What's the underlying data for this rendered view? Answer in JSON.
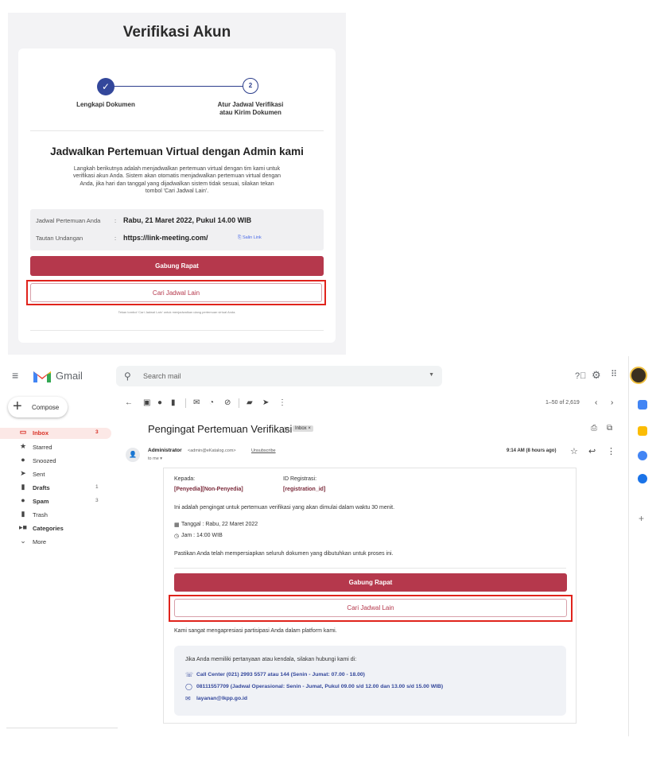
{
  "verification": {
    "title": "Verifikasi Akun",
    "step1_label": "Lengkapi Dokumen",
    "step1_icon": "check-icon",
    "step2_number": "2",
    "step2_label_line1": "Atur Jadwal Verifikasi",
    "step2_label_line2": "atau Kirim Dokumen",
    "heading": "Jadwalkan Pertemuan Virtual dengan Admin kami",
    "description_lines": [
      "Langkah berikutnya adalah menjadwalkan pertemuan virtual dengan tim kami untuk",
      "verifikasi akun Anda. Sistem akan otomatis menjadwalkan pertemuan virtual dengan",
      "Anda, jika hari dan tanggal yang dijadwalkan sistem tidak sesuai, silakan tekan",
      "tombol 'Cari Jadwal Lain'."
    ],
    "meeting_label": "Jadwal Pertemuan Anda",
    "separator": ":",
    "meeting_value": "Rabu, 21 Maret 2022, Pukul 14.00 WIB",
    "link_label": "Tautan Undangan",
    "link_value": "https://link-meeting.com/",
    "copy_link": "Salin Link",
    "join_button": "Gabung Rapat",
    "other_schedule_button": "Cari Jadwal Lain",
    "note": "Tekan tombol 'Cari Jadwal Lain' untuk menjadwalkan ulang pertemuan virtual Anda."
  },
  "gmail": {
    "brand": "Gmail",
    "search_placeholder": "Search mail",
    "compose": "Compose",
    "nav": [
      {
        "label": "Inbox",
        "count": "3",
        "icon": "inbox-icon"
      },
      {
        "label": "Starred",
        "count": "",
        "icon": "star-icon"
      },
      {
        "label": "Snoozed",
        "count": "",
        "icon": "clock-icon"
      },
      {
        "label": "Sent",
        "count": "",
        "icon": "send-icon"
      },
      {
        "label": "Drafts",
        "count": "1",
        "icon": "draft-icon"
      },
      {
        "label": "Spam",
        "count": "3",
        "icon": "spam-icon"
      },
      {
        "label": "Trash",
        "count": "",
        "icon": "trash-icon"
      },
      {
        "label": "Categories",
        "count": "",
        "icon": "label-icon"
      },
      {
        "label": "More",
        "count": "",
        "icon": "chevron-down-icon"
      }
    ],
    "pagination": "1–50 of 2,619",
    "subject": "Pengingat Pertemuan Verifikasi",
    "inbox_badge": "Inbox ×",
    "sender_name": "Administrator",
    "sender_email": "<admin@eKatalog.com>",
    "unsubscribe": "Unsubscribe",
    "to_me": "to me ▾",
    "time": "9:14 AM (8 hours ago)",
    "email": {
      "to_label": "Kepada:",
      "to_value": "[Penyedia][Non-Penyedia]",
      "reg_label": "ID Registrasi:",
      "reg_value": "[registration_id]",
      "intro": "Ini adalah pengingat untuk pertemuan verifikasi yang akan dimulai dalam waktu 30 menit.",
      "date": "Tanggal : Rabu, 22 Maret 2022",
      "time": "Jam : 14:00 WIB",
      "prepare": "Pastikan Anda telah mempersiapkan seluruh dokumen yang dibutuhkan untuk proses ini.",
      "join_button": "Gabung Rapat",
      "other_schedule_button": "Cari Jadwal Lain",
      "thanks": "Kami sangat mengapresiasi partisipasi Anda dalam platform kami.",
      "contact_intro": "Jika Anda memiliki pertanyaan atau kendala, silakan hubungi kami di:",
      "call_center": "Call Center (021) 2993 5577 atau 144 (Senin - Jumat: 07.00 - 18.00)",
      "whatsapp": "08111557709 (Jadwal Operasional: Senin - Jumat, Pukul 09.00 s/d 12.00 dan  13.00 s/d 15.00 WIB)",
      "email": "layanan@lkpp.go.id"
    }
  },
  "colors": {
    "primary": "#b5384c",
    "accent_blue": "#33479b",
    "highlight": "#e0231c"
  }
}
